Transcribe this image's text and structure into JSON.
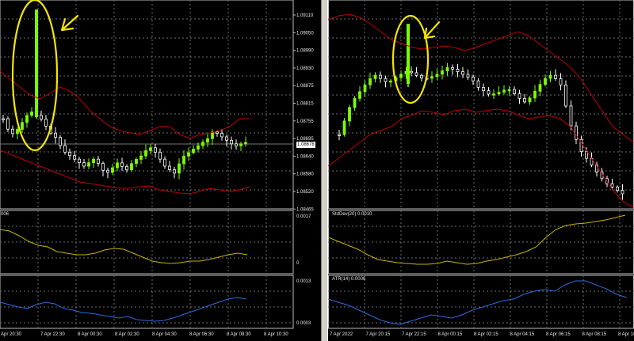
{
  "colors": {
    "background": "#000000",
    "grid": "#6e6e6e",
    "bull_candle": "#7cfc00",
    "bear_candle": "#ffffff",
    "bollinger": "#c00000",
    "stddev_line": "#c8b400",
    "atr_line": "#2d6cdf",
    "annotation": "#f5e600"
  },
  "left_chart": {
    "price_ticks": [
      "1.09110",
      "1.09050",
      "1.08990",
      "1.08930",
      "1.08875",
      "1.08815",
      "1.08755",
      "1.08695",
      "1.08640",
      "1.08580",
      "1.08520",
      "1.08465"
    ],
    "current_price": "1.08678",
    "stddev_panel": {
      "label_fragment": "006",
      "top_tick": "0.0017",
      "bottom_tick": "0"
    },
    "atr_panel": {
      "top_tick": "0.0013",
      "bottom_tick": "0.0003"
    },
    "time_labels": [
      "Apr 20:30",
      "7 Apr 22:30",
      "8 Apr 00:30",
      "8 Apr 02:30",
      "8 Apr 04:30",
      "8 Apr 06:30",
      "8 Apr 08:30",
      "8 Apr 10:30"
    ]
  },
  "right_chart": {
    "stddev_panel": {
      "label": "StdDev(20) 0.0010"
    },
    "atr_panel": {
      "label": "ATR(14) 0.0006"
    },
    "time_labels": [
      "7 Apr 2022",
      "7 Apr 20:15",
      "7 Apr 22:15",
      "8 Apr 00:15",
      "8 Apr 02:15",
      "8 Apr 04:15",
      "8 Apr 06:15",
      "8 Apr 08:15",
      "8 Apr 10:15"
    ]
  }
}
